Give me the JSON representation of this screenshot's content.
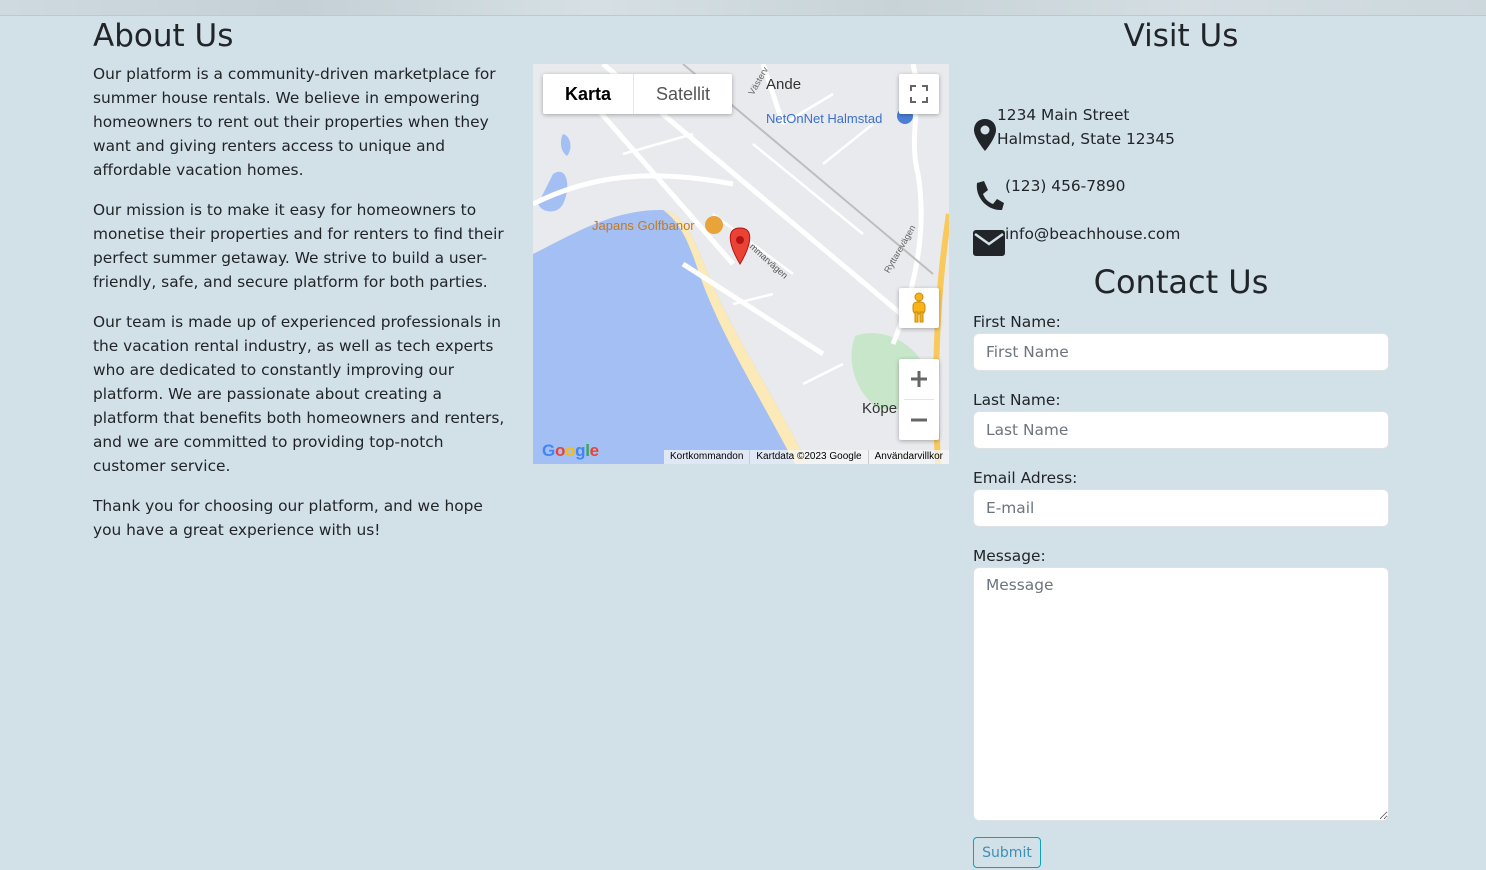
{
  "about": {
    "title": "About Us",
    "paragraphs": [
      "Our platform is a community-driven marketplace for summer house rentals. We believe in empowering homeowners to rent out their properties when they want and giving renters access to unique and affordable vacation homes.",
      "Our mission is to make it easy for homeowners to monetise their properties and for renters to find their perfect summer getaway. We strive to build a user-friendly, safe, and secure platform for both parties.",
      "Our team is made up of experienced professionals in the vacation rental industry, as well as tech experts who are dedicated to constantly improving our platform. We are passionate about creating a platform that benefits both homeowners and renters, and we are committed to providing top-notch customer service.",
      "Thank you for choosing our platform, and we hope you have a great experience with us!"
    ]
  },
  "map": {
    "type_tabs": [
      "Karta",
      "Satellit"
    ],
    "active_tab": "Karta",
    "labels": {
      "golf": "Japans Golfbanor",
      "store": "NetOnNet Halmstad",
      "top_right": "Ande",
      "bottom_right": "Köpe",
      "street_1": "Västerv",
      "street_2": "mmarvägen",
      "street_3": "Ryttarevägen"
    },
    "footer": [
      "Kortkommandon",
      "Kartdata ©2023 Google",
      "Användarvillkor"
    ],
    "logo": "Google",
    "icons": [
      "fullscreen-icon",
      "pegman-icon",
      "zoom-in-icon",
      "zoom-out-icon",
      "map-marker-icon"
    ],
    "colors": {
      "water": "#a3bff4",
      "beach": "#fbe9b7",
      "park": "#c8e6c9",
      "marker": "#ea4335"
    }
  },
  "visit": {
    "title": "Visit Us",
    "address_line1": "1234 Main Street",
    "address_line2": "Halmstad, State 12345",
    "phone": "(123) 456-7890",
    "email": "info@beachhouse.com",
    "icons": [
      "location-pin-icon",
      "phone-icon",
      "envelope-icon"
    ]
  },
  "contact": {
    "title": "Contact Us",
    "first_name_label": "First Name:",
    "first_name_placeholder": "First Name",
    "last_name_label": "Last Name:",
    "last_name_placeholder": "Last Name",
    "email_label": "Email Adress:",
    "email_placeholder": "E-mail",
    "message_label": "Message:",
    "message_placeholder": "Message",
    "submit_label": "Submit"
  }
}
